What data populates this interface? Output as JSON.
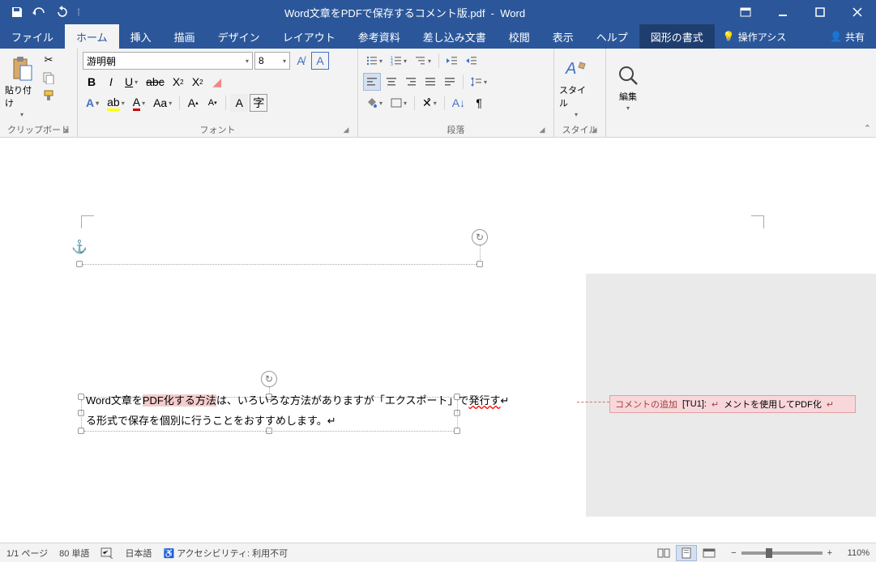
{
  "title": {
    "filename": "Word文章をPDFで保存するコメント版.pdf",
    "app": "Word"
  },
  "tabs": {
    "file": "ファイル",
    "home": "ホーム",
    "insert": "挿入",
    "draw": "描画",
    "design": "デザイン",
    "layout": "レイアウト",
    "references": "参考資料",
    "mailings": "差し込み文書",
    "review": "校閲",
    "view": "表示",
    "help": "ヘルプ",
    "shape_format": "図形の書式",
    "tell_me": "操作アシス",
    "share": "共有"
  },
  "ribbon": {
    "clipboard": {
      "label": "クリップボード",
      "paste": "貼り付け"
    },
    "font": {
      "label": "フォント",
      "name": "游明朝",
      "size": "8"
    },
    "paragraph": {
      "label": "段落"
    },
    "styles": {
      "label": "スタイル",
      "button": "スタイル"
    },
    "editing": {
      "label": "",
      "button": "編集"
    }
  },
  "document": {
    "line1_pre": "Word文章を",
    "line1_hl": "PDF化する方法",
    "line1_post": "は、いろいろな方法がありますが「エクスポート」で",
    "line1_sq": "発行す",
    "line2": "る形式で保存を個別に行うことをおすすめします。"
  },
  "comment": {
    "add_label": "コメントの追加",
    "ref": "[TU1]:",
    "text": "メントを使用してPDF化"
  },
  "status": {
    "page": "1/1 ページ",
    "words": "80 単語",
    "language": "日本語",
    "accessibility": "アクセシビリティ: 利用不可",
    "zoom": "110%"
  }
}
